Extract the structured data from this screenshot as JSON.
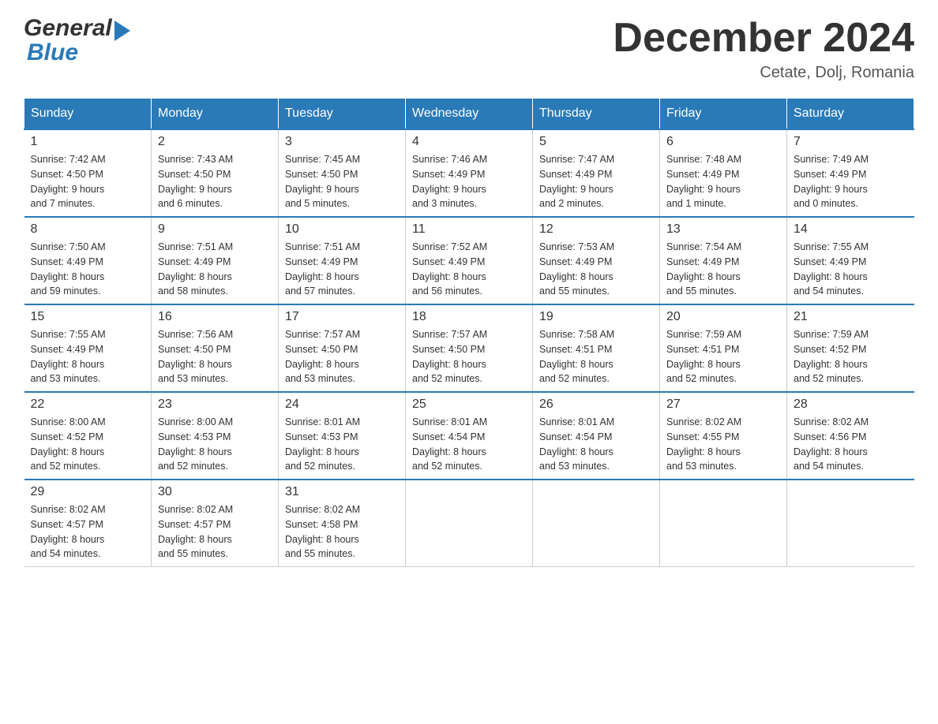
{
  "header": {
    "title": "December 2024",
    "location": "Cetate, Dolj, Romania"
  },
  "days_of_week": [
    "Sunday",
    "Monday",
    "Tuesday",
    "Wednesday",
    "Thursday",
    "Friday",
    "Saturday"
  ],
  "weeks": [
    [
      {
        "day": "1",
        "sunrise": "7:42 AM",
        "sunset": "4:50 PM",
        "daylight": "9 hours and 7 minutes."
      },
      {
        "day": "2",
        "sunrise": "7:43 AM",
        "sunset": "4:50 PM",
        "daylight": "9 hours and 6 minutes."
      },
      {
        "day": "3",
        "sunrise": "7:45 AM",
        "sunset": "4:50 PM",
        "daylight": "9 hours and 5 minutes."
      },
      {
        "day": "4",
        "sunrise": "7:46 AM",
        "sunset": "4:49 PM",
        "daylight": "9 hours and 3 minutes."
      },
      {
        "day": "5",
        "sunrise": "7:47 AM",
        "sunset": "4:49 PM",
        "daylight": "9 hours and 2 minutes."
      },
      {
        "day": "6",
        "sunrise": "7:48 AM",
        "sunset": "4:49 PM",
        "daylight": "9 hours and 1 minute."
      },
      {
        "day": "7",
        "sunrise": "7:49 AM",
        "sunset": "4:49 PM",
        "daylight": "9 hours and 0 minutes."
      }
    ],
    [
      {
        "day": "8",
        "sunrise": "7:50 AM",
        "sunset": "4:49 PM",
        "daylight": "8 hours and 59 minutes."
      },
      {
        "day": "9",
        "sunrise": "7:51 AM",
        "sunset": "4:49 PM",
        "daylight": "8 hours and 58 minutes."
      },
      {
        "day": "10",
        "sunrise": "7:51 AM",
        "sunset": "4:49 PM",
        "daylight": "8 hours and 57 minutes."
      },
      {
        "day": "11",
        "sunrise": "7:52 AM",
        "sunset": "4:49 PM",
        "daylight": "8 hours and 56 minutes."
      },
      {
        "day": "12",
        "sunrise": "7:53 AM",
        "sunset": "4:49 PM",
        "daylight": "8 hours and 55 minutes."
      },
      {
        "day": "13",
        "sunrise": "7:54 AM",
        "sunset": "4:49 PM",
        "daylight": "8 hours and 55 minutes."
      },
      {
        "day": "14",
        "sunrise": "7:55 AM",
        "sunset": "4:49 PM",
        "daylight": "8 hours and 54 minutes."
      }
    ],
    [
      {
        "day": "15",
        "sunrise": "7:55 AM",
        "sunset": "4:49 PM",
        "daylight": "8 hours and 53 minutes."
      },
      {
        "day": "16",
        "sunrise": "7:56 AM",
        "sunset": "4:50 PM",
        "daylight": "8 hours and 53 minutes."
      },
      {
        "day": "17",
        "sunrise": "7:57 AM",
        "sunset": "4:50 PM",
        "daylight": "8 hours and 53 minutes."
      },
      {
        "day": "18",
        "sunrise": "7:57 AM",
        "sunset": "4:50 PM",
        "daylight": "8 hours and 52 minutes."
      },
      {
        "day": "19",
        "sunrise": "7:58 AM",
        "sunset": "4:51 PM",
        "daylight": "8 hours and 52 minutes."
      },
      {
        "day": "20",
        "sunrise": "7:59 AM",
        "sunset": "4:51 PM",
        "daylight": "8 hours and 52 minutes."
      },
      {
        "day": "21",
        "sunrise": "7:59 AM",
        "sunset": "4:52 PM",
        "daylight": "8 hours and 52 minutes."
      }
    ],
    [
      {
        "day": "22",
        "sunrise": "8:00 AM",
        "sunset": "4:52 PM",
        "daylight": "8 hours and 52 minutes."
      },
      {
        "day": "23",
        "sunrise": "8:00 AM",
        "sunset": "4:53 PM",
        "daylight": "8 hours and 52 minutes."
      },
      {
        "day": "24",
        "sunrise": "8:01 AM",
        "sunset": "4:53 PM",
        "daylight": "8 hours and 52 minutes."
      },
      {
        "day": "25",
        "sunrise": "8:01 AM",
        "sunset": "4:54 PM",
        "daylight": "8 hours and 52 minutes."
      },
      {
        "day": "26",
        "sunrise": "8:01 AM",
        "sunset": "4:54 PM",
        "daylight": "8 hours and 53 minutes."
      },
      {
        "day": "27",
        "sunrise": "8:02 AM",
        "sunset": "4:55 PM",
        "daylight": "8 hours and 53 minutes."
      },
      {
        "day": "28",
        "sunrise": "8:02 AM",
        "sunset": "4:56 PM",
        "daylight": "8 hours and 54 minutes."
      }
    ],
    [
      {
        "day": "29",
        "sunrise": "8:02 AM",
        "sunset": "4:57 PM",
        "daylight": "8 hours and 54 minutes."
      },
      {
        "day": "30",
        "sunrise": "8:02 AM",
        "sunset": "4:57 PM",
        "daylight": "8 hours and 55 minutes."
      },
      {
        "day": "31",
        "sunrise": "8:02 AM",
        "sunset": "4:58 PM",
        "daylight": "8 hours and 55 minutes."
      },
      null,
      null,
      null,
      null
    ]
  ],
  "labels": {
    "sunrise": "Sunrise:",
    "sunset": "Sunset:",
    "daylight": "Daylight:"
  }
}
